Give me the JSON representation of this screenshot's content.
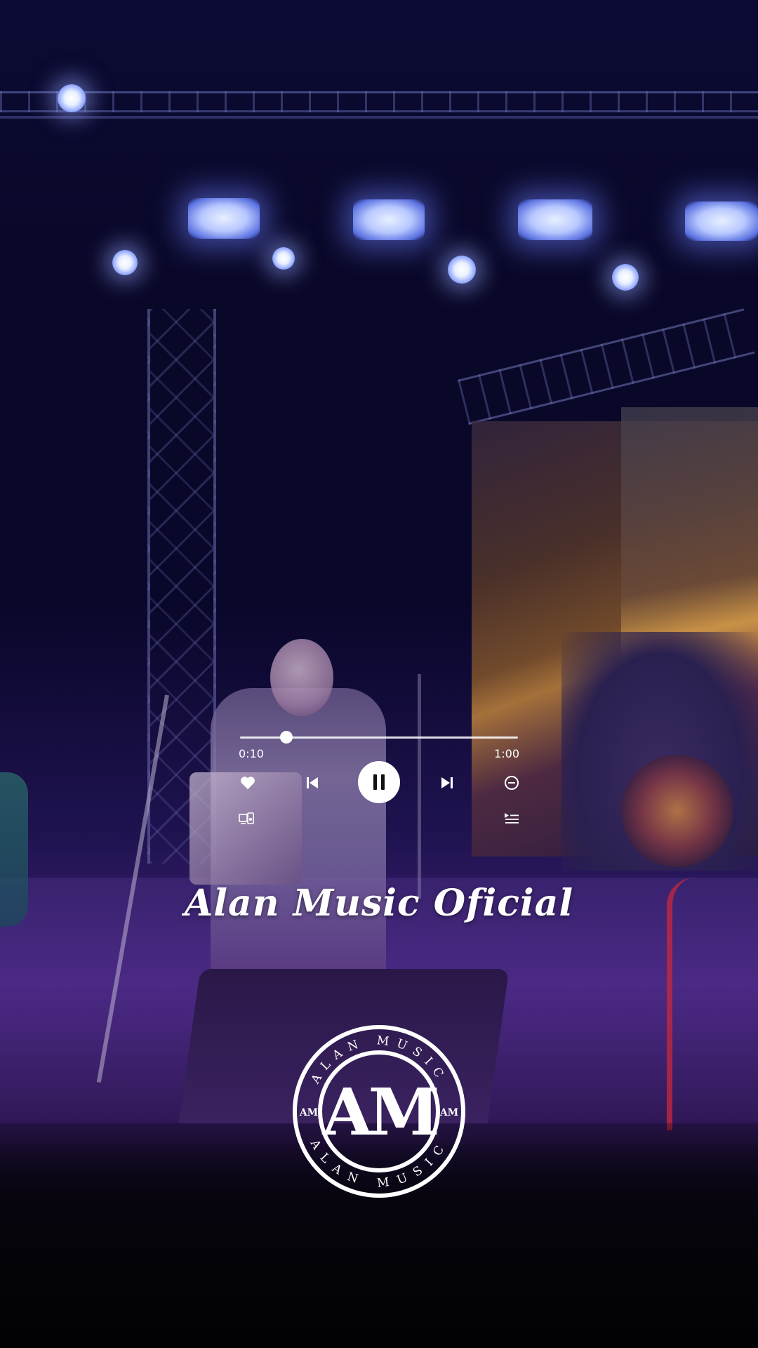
{
  "player": {
    "elapsed": "0:10",
    "total": "1:00",
    "progress_fraction": 0.167,
    "state": "playing",
    "icons": {
      "like": "heart-icon",
      "prev": "skip-previous-icon",
      "play": "pause-icon",
      "next": "skip-next-icon",
      "remove": "minus-circle-icon",
      "device": "connect-device-icon",
      "queue": "queue-icon"
    }
  },
  "brand": {
    "title": "Alan Music Oficial"
  },
  "logo": {
    "ring_text_top": "ALAN MUSIC",
    "ring_text_bottom": "ALAN MUSIC",
    "monogram": "AM",
    "side_badge_left": "AM",
    "side_badge_right": "AM"
  },
  "colors": {
    "foreground": "#ffffff",
    "overlay_tint": "#3a1d6e"
  }
}
